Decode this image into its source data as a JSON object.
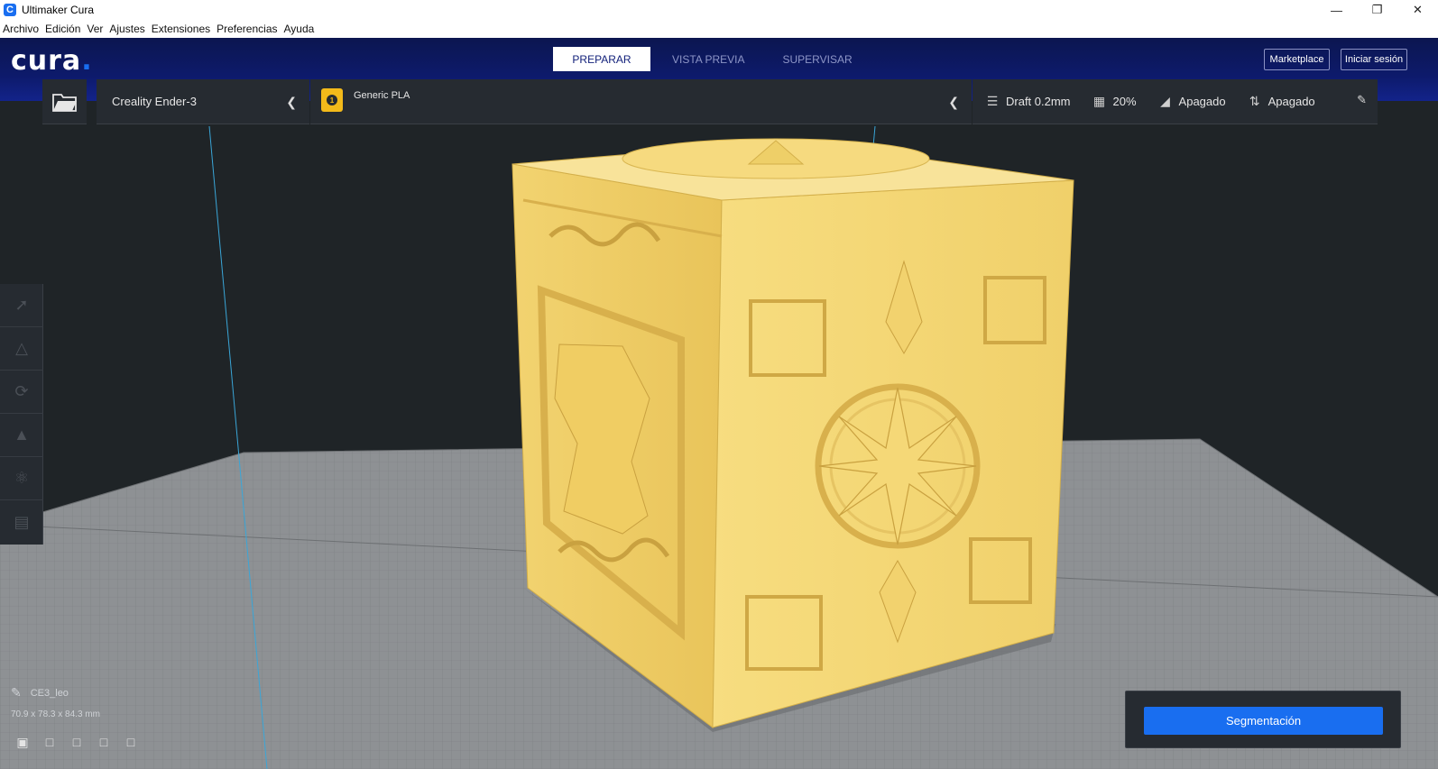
{
  "window": {
    "title": "Ultimaker Cura",
    "icon": "cura-app-icon"
  },
  "menu": [
    "Archivo",
    "Edición",
    "Ver",
    "Ajustes",
    "Extensiones",
    "Preferencias",
    "Ayuda"
  ],
  "header": {
    "logo": "cura",
    "tabs": [
      {
        "label": "PREPARAR",
        "active": true
      },
      {
        "label": "VISTA PREVIA",
        "active": false
      },
      {
        "label": "SUPERVISAR",
        "active": false
      }
    ],
    "marketplace_label": "Marketplace",
    "signin_label": "Iniciar sesión"
  },
  "toolbar": {
    "printer": "Creality Ender-3",
    "extruder_number": "1",
    "material": "Generic PLA",
    "profile": "Draft 0.2mm",
    "infill": "20%",
    "support": "Apagado",
    "adhesion": "Apagado"
  },
  "object": {
    "name": "CE3_leo",
    "dimensions": "70.9 x 78.3 x 84.3 mm"
  },
  "slice": {
    "button_label": "Segmentación"
  },
  "colors": {
    "accent": "#196ef0",
    "header": "#0d1a6b",
    "model": "#f4d97a",
    "build_plate": "#8a8d90"
  }
}
